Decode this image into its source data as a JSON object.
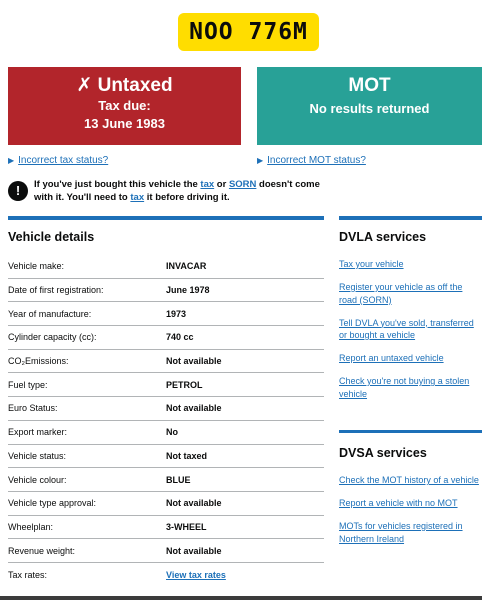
{
  "plate": "NOO 776M",
  "tax_status": {
    "title": "✗ Untaxed",
    "line1": "Tax due:",
    "line2": "13 June 1983"
  },
  "mot_status": {
    "title": "MOT",
    "line1": "No results returned"
  },
  "links": {
    "incorrect_tax": "Incorrect tax status?",
    "incorrect_mot": "Incorrect MOT status?"
  },
  "warning": {
    "icon": "!",
    "text_a": "If you've just bought this vehicle the ",
    "tax_link": "tax",
    "text_b": " or ",
    "sorn_link": "SORN",
    "text_c": " doesn't come with it. You'll need to ",
    "tax_link2": "tax",
    "text_d": " it before driving it."
  },
  "vehicle_details": {
    "title": "Vehicle details",
    "rows": [
      {
        "label": "Vehicle make:",
        "value": "INVACAR"
      },
      {
        "label": "Date of first registration:",
        "value": "June 1978"
      },
      {
        "label": "Year of manufacture:",
        "value": "1973"
      },
      {
        "label": "Cylinder capacity (cc):",
        "value": "740 cc"
      },
      {
        "label": "CO₂Emissions:",
        "value": "Not available"
      },
      {
        "label": "Fuel type:",
        "value": "PETROL"
      },
      {
        "label": "Euro Status:",
        "value": "Not available"
      },
      {
        "label": "Export marker:",
        "value": "No"
      },
      {
        "label": "Vehicle status:",
        "value": "Not taxed"
      },
      {
        "label": "Vehicle colour:",
        "value": "BLUE"
      },
      {
        "label": "Vehicle type approval:",
        "value": "Not available"
      },
      {
        "label": "Wheelplan:",
        "value": "3-WHEEL"
      },
      {
        "label": "Revenue weight:",
        "value": "Not available"
      },
      {
        "label": "Tax rates:",
        "value": "View tax rates"
      }
    ]
  },
  "dvla_services": {
    "title": "DVLA services",
    "links": [
      [
        "Tax your vehicle"
      ],
      [
        "Register your vehicle as off the",
        "road (SORN)"
      ],
      [
        "Tell DVLA you've sold, transferred",
        "or bought a vehicle"
      ],
      [
        "Report an untaxed vehicle"
      ],
      [
        "Check you're not buying a stolen",
        "vehicle"
      ]
    ]
  },
  "dvsa_services": {
    "title": "DVSA services",
    "links": [
      [
        "Check the MOT history of a vehicle"
      ],
      [
        "Report a vehicle with no MOT"
      ],
      [
        "MOTs for vehicles registered in",
        "Northern Ireland"
      ]
    ]
  },
  "colors": {
    "untaxed": "#b2252b",
    "mot": "#28a197",
    "plate": "#ffdd00",
    "link": "#1d70b8"
  }
}
